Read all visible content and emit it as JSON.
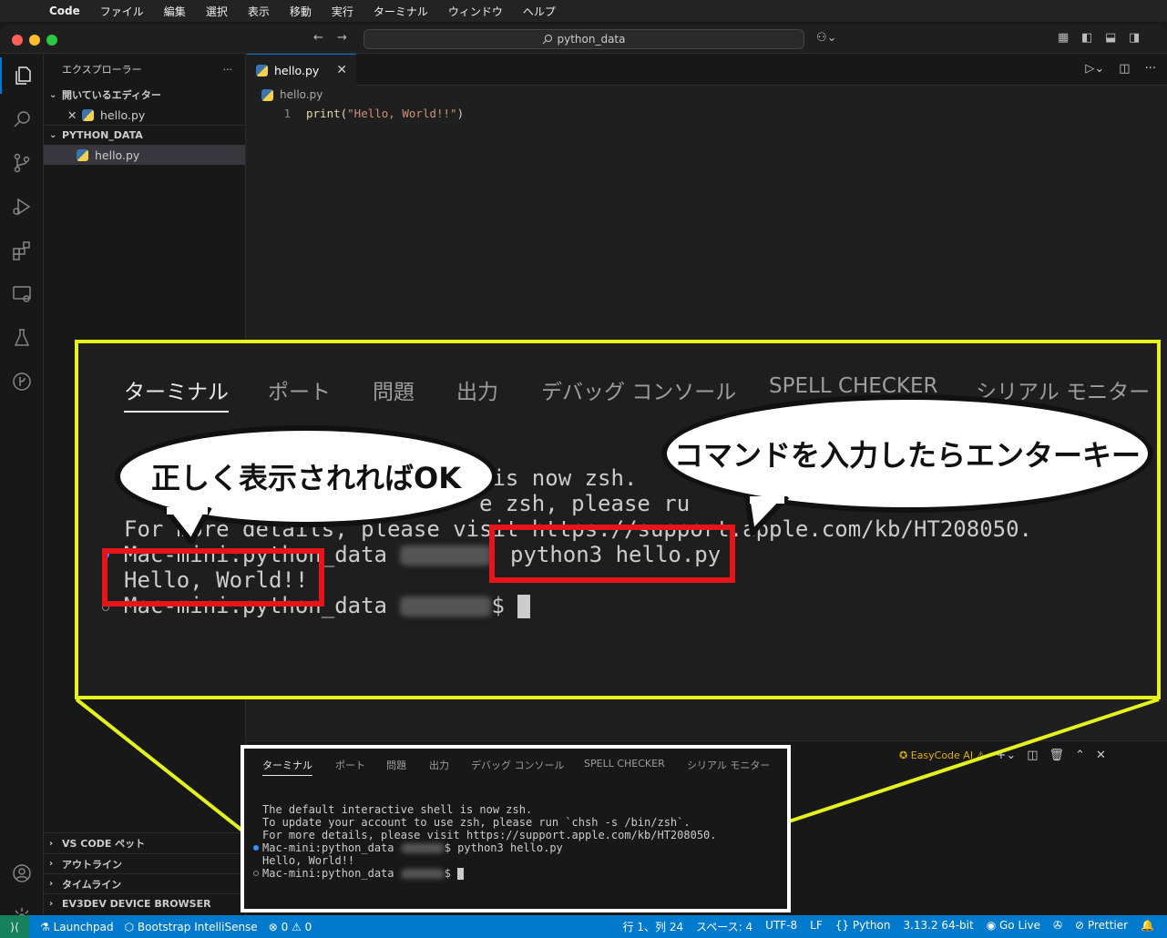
{
  "menubar": {
    "app": "Code",
    "items": [
      "ファイル",
      "編集",
      "選択",
      "表示",
      "移動",
      "実行",
      "ターミナル",
      "ウィンドウ",
      "ヘルプ"
    ]
  },
  "titlebar": {
    "search": "python_data"
  },
  "sidebar": {
    "title": "エクスプローラー",
    "open_editors_label": "開いているエディター",
    "open_editor_file": "hello.py",
    "folder_label": "PYTHON_DATA",
    "folder_file": "hello.py",
    "bottom_sections": [
      "VS CODE ペット",
      "アウトライン",
      "タイムライン",
      "EV3DEV DEVICE BROWSER"
    ]
  },
  "editor": {
    "tab_label": "hello.py",
    "breadcrumb": "hello.py",
    "line_number": "1",
    "code_fn": "print(",
    "code_str": "\"Hello, World!!\"",
    "code_end": ")"
  },
  "panel": {
    "tabs": [
      "ターミナル",
      "ポート",
      "問題",
      "出力",
      "デバッグ コンソール",
      "SPELL CHECKER",
      "シリアル モニター"
    ],
    "easycode": "EasyCode AI",
    "terminal_lines": [
      "The default interactive shell is now zsh.",
      "To update your account to use zsh, please run `chsh -s /bin/zsh`.",
      "For more details, please visit https://support.apple.com/kb/HT208050."
    ],
    "prompt_host": "Mac-mini:python_data",
    "command": "$ python3 hello.py",
    "output": "Hello, World!!",
    "prompt_end": "$"
  },
  "zoom": {
    "tabs": [
      "ターミナル",
      "ポート",
      "問題",
      "出力",
      "デバッグ コンソール",
      "SPELL CHECKER",
      "シリアル モニター"
    ],
    "line1": " is now zsh.",
    "line2": "e zsh, please ru",
    "line3": "For more details, please visit https://support.apple.com/kb/HT208050.",
    "prompt": "Mac-mini:python_data",
    "command": "python3 hello.py",
    "output": "Hello, World!!",
    "prompt2": "Mac-mini:python_data",
    "dollar": "$",
    "bubble_left": "正しく表示されればOK",
    "bubble_right": "コマンドを入力したらエンターキー"
  },
  "statusbar": {
    "launchpad": "Launchpad",
    "bootstrap": "Bootstrap IntelliSense",
    "problems": "⊗ 0 ⚠ 0",
    "position": "行 1、列 24",
    "spaces": "スペース: 4",
    "encoding": "UTF-8",
    "eol": "LF",
    "language": "Python",
    "version": "3.13.2 64-bit",
    "golive": "Go Live",
    "prettier": "Prettier"
  }
}
